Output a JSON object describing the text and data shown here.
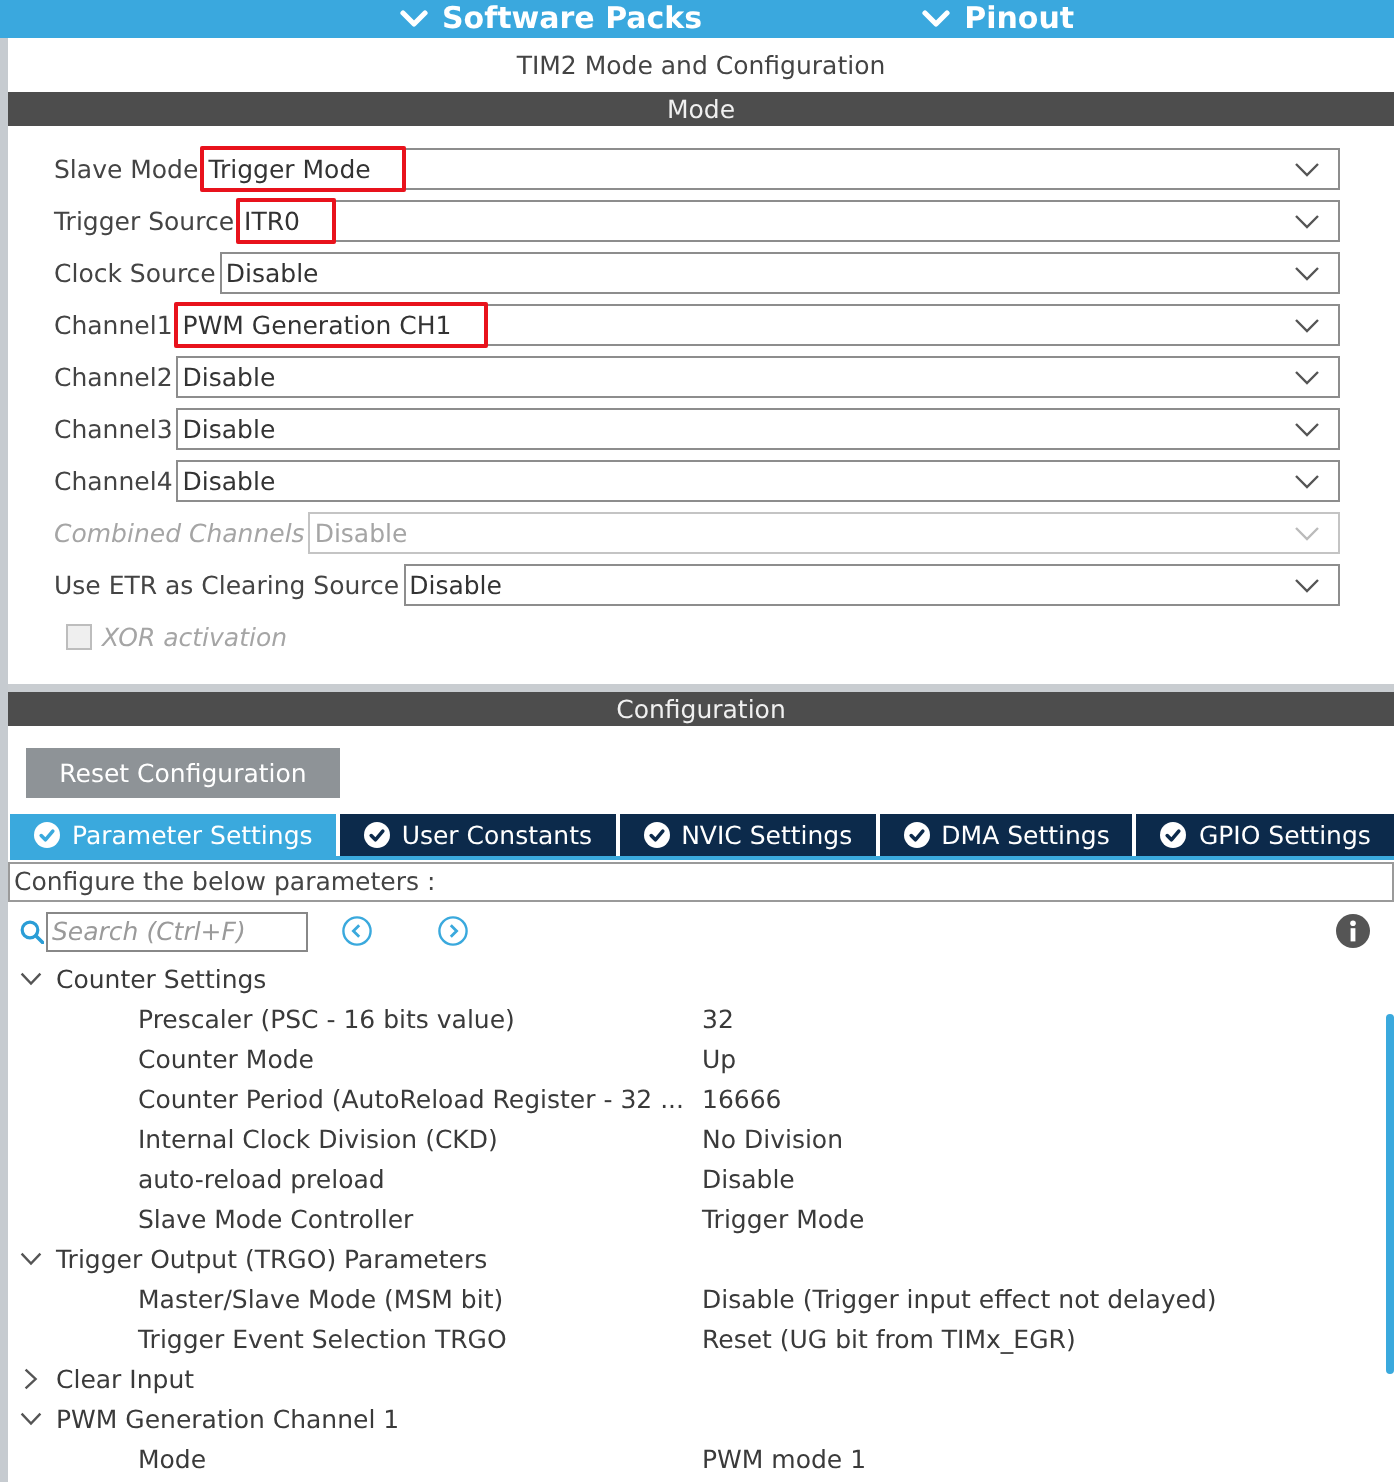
{
  "top_bar": {
    "menus": [
      {
        "label": "Software Packs"
      },
      {
        "label": "Pinout"
      }
    ]
  },
  "panel": {
    "title": "TIM2 Mode and Configuration"
  },
  "mode": {
    "header": "Mode",
    "fields": [
      {
        "kind": "dropdown",
        "label": "Slave Mode",
        "value": "Trigger Mode",
        "highlighted": true,
        "disabled": false
      },
      {
        "kind": "dropdown",
        "label": "Trigger Source",
        "value": "ITR0",
        "highlighted": true,
        "disabled": false
      },
      {
        "kind": "dropdown",
        "label": "Clock Source",
        "value": "Disable",
        "highlighted": false,
        "disabled": false
      },
      {
        "kind": "dropdown",
        "label": "Channel1",
        "value": "PWM Generation CH1",
        "highlighted": true,
        "disabled": false
      },
      {
        "kind": "dropdown",
        "label": "Channel2",
        "value": "Disable",
        "highlighted": false,
        "disabled": false
      },
      {
        "kind": "dropdown",
        "label": "Channel3",
        "value": "Disable",
        "highlighted": false,
        "disabled": false
      },
      {
        "kind": "dropdown",
        "label": "Channel4",
        "value": "Disable",
        "highlighted": false,
        "disabled": false
      },
      {
        "kind": "dropdown",
        "label": "Combined Channels",
        "value": "Disable",
        "highlighted": false,
        "disabled": true
      },
      {
        "kind": "dropdown",
        "label": "Use ETR as Clearing Source",
        "value": "Disable",
        "highlighted": false,
        "disabled": false
      },
      {
        "kind": "checkbox",
        "label": "XOR activation",
        "checked": false,
        "disabled": true
      }
    ]
  },
  "configuration": {
    "header": "Configuration",
    "reset_button": "Reset Configuration",
    "tabs": [
      {
        "label": "Parameter Settings",
        "selected": true
      },
      {
        "label": "User Constants",
        "selected": false
      },
      {
        "label": "NVIC Settings",
        "selected": false
      },
      {
        "label": "DMA Settings",
        "selected": false
      },
      {
        "label": "GPIO Settings",
        "selected": false
      }
    ],
    "hint": "Configure the below parameters :",
    "search": {
      "placeholder": "Search (Ctrl+F)"
    },
    "tree": [
      {
        "label": "Counter Settings",
        "expanded": true,
        "children": [
          {
            "label": "Prescaler (PSC - 16 bits value)",
            "value": "32"
          },
          {
            "label": "Counter Mode",
            "value": "Up"
          },
          {
            "label": "Counter Period (AutoReload Register - 32 ...",
            "value": "16666"
          },
          {
            "label": "Internal Clock Division (CKD)",
            "value": "No Division"
          },
          {
            "label": "auto-reload preload",
            "value": "Disable"
          },
          {
            "label": "Slave Mode Controller",
            "value": "Trigger Mode"
          }
        ]
      },
      {
        "label": "Trigger Output (TRGO) Parameters",
        "expanded": true,
        "children": [
          {
            "label": "Master/Slave Mode (MSM bit)",
            "value": "Disable (Trigger input effect not delayed)"
          },
          {
            "label": "Trigger Event Selection TRGO",
            "value": "Reset (UG bit from TIMx_EGR)"
          }
        ]
      },
      {
        "label": "Clear Input",
        "expanded": false
      },
      {
        "label": "PWM Generation Channel 1",
        "expanded": true,
        "children": [
          {
            "label": "Mode",
            "value": "PWM mode 1"
          }
        ]
      }
    ]
  }
}
